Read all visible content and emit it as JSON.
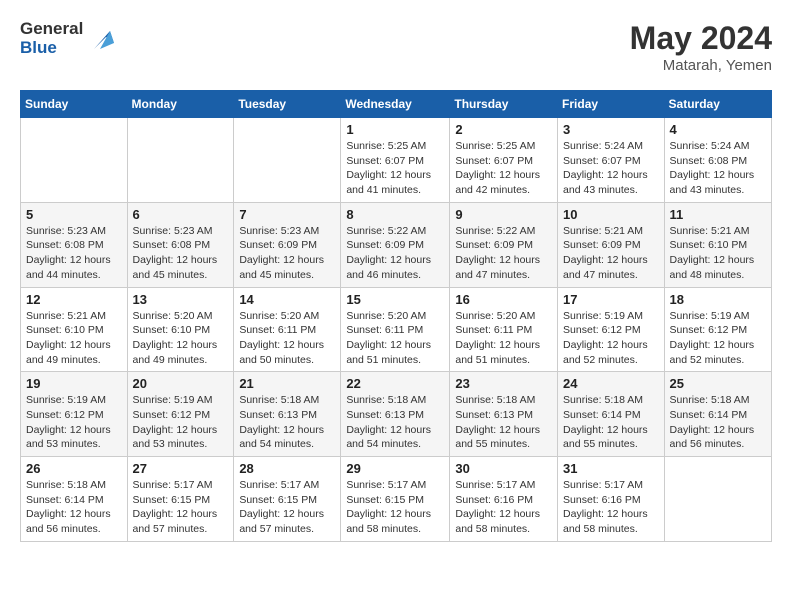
{
  "header": {
    "logo_line1": "General",
    "logo_line2": "Blue",
    "month_year": "May 2024",
    "location": "Matarah, Yemen"
  },
  "weekdays": [
    "Sunday",
    "Monday",
    "Tuesday",
    "Wednesday",
    "Thursday",
    "Friday",
    "Saturday"
  ],
  "weeks": [
    [
      {
        "day": "",
        "info": ""
      },
      {
        "day": "",
        "info": ""
      },
      {
        "day": "",
        "info": ""
      },
      {
        "day": "1",
        "info": "Sunrise: 5:25 AM\nSunset: 6:07 PM\nDaylight: 12 hours\nand 41 minutes."
      },
      {
        "day": "2",
        "info": "Sunrise: 5:25 AM\nSunset: 6:07 PM\nDaylight: 12 hours\nand 42 minutes."
      },
      {
        "day": "3",
        "info": "Sunrise: 5:24 AM\nSunset: 6:07 PM\nDaylight: 12 hours\nand 43 minutes."
      },
      {
        "day": "4",
        "info": "Sunrise: 5:24 AM\nSunset: 6:08 PM\nDaylight: 12 hours\nand 43 minutes."
      }
    ],
    [
      {
        "day": "5",
        "info": "Sunrise: 5:23 AM\nSunset: 6:08 PM\nDaylight: 12 hours\nand 44 minutes."
      },
      {
        "day": "6",
        "info": "Sunrise: 5:23 AM\nSunset: 6:08 PM\nDaylight: 12 hours\nand 45 minutes."
      },
      {
        "day": "7",
        "info": "Sunrise: 5:23 AM\nSunset: 6:09 PM\nDaylight: 12 hours\nand 45 minutes."
      },
      {
        "day": "8",
        "info": "Sunrise: 5:22 AM\nSunset: 6:09 PM\nDaylight: 12 hours\nand 46 minutes."
      },
      {
        "day": "9",
        "info": "Sunrise: 5:22 AM\nSunset: 6:09 PM\nDaylight: 12 hours\nand 47 minutes."
      },
      {
        "day": "10",
        "info": "Sunrise: 5:21 AM\nSunset: 6:09 PM\nDaylight: 12 hours\nand 47 minutes."
      },
      {
        "day": "11",
        "info": "Sunrise: 5:21 AM\nSunset: 6:10 PM\nDaylight: 12 hours\nand 48 minutes."
      }
    ],
    [
      {
        "day": "12",
        "info": "Sunrise: 5:21 AM\nSunset: 6:10 PM\nDaylight: 12 hours\nand 49 minutes."
      },
      {
        "day": "13",
        "info": "Sunrise: 5:20 AM\nSunset: 6:10 PM\nDaylight: 12 hours\nand 49 minutes."
      },
      {
        "day": "14",
        "info": "Sunrise: 5:20 AM\nSunset: 6:11 PM\nDaylight: 12 hours\nand 50 minutes."
      },
      {
        "day": "15",
        "info": "Sunrise: 5:20 AM\nSunset: 6:11 PM\nDaylight: 12 hours\nand 51 minutes."
      },
      {
        "day": "16",
        "info": "Sunrise: 5:20 AM\nSunset: 6:11 PM\nDaylight: 12 hours\nand 51 minutes."
      },
      {
        "day": "17",
        "info": "Sunrise: 5:19 AM\nSunset: 6:12 PM\nDaylight: 12 hours\nand 52 minutes."
      },
      {
        "day": "18",
        "info": "Sunrise: 5:19 AM\nSunset: 6:12 PM\nDaylight: 12 hours\nand 52 minutes."
      }
    ],
    [
      {
        "day": "19",
        "info": "Sunrise: 5:19 AM\nSunset: 6:12 PM\nDaylight: 12 hours\nand 53 minutes."
      },
      {
        "day": "20",
        "info": "Sunrise: 5:19 AM\nSunset: 6:12 PM\nDaylight: 12 hours\nand 53 minutes."
      },
      {
        "day": "21",
        "info": "Sunrise: 5:18 AM\nSunset: 6:13 PM\nDaylight: 12 hours\nand 54 minutes."
      },
      {
        "day": "22",
        "info": "Sunrise: 5:18 AM\nSunset: 6:13 PM\nDaylight: 12 hours\nand 54 minutes."
      },
      {
        "day": "23",
        "info": "Sunrise: 5:18 AM\nSunset: 6:13 PM\nDaylight: 12 hours\nand 55 minutes."
      },
      {
        "day": "24",
        "info": "Sunrise: 5:18 AM\nSunset: 6:14 PM\nDaylight: 12 hours\nand 55 minutes."
      },
      {
        "day": "25",
        "info": "Sunrise: 5:18 AM\nSunset: 6:14 PM\nDaylight: 12 hours\nand 56 minutes."
      }
    ],
    [
      {
        "day": "26",
        "info": "Sunrise: 5:18 AM\nSunset: 6:14 PM\nDaylight: 12 hours\nand 56 minutes."
      },
      {
        "day": "27",
        "info": "Sunrise: 5:17 AM\nSunset: 6:15 PM\nDaylight: 12 hours\nand 57 minutes."
      },
      {
        "day": "28",
        "info": "Sunrise: 5:17 AM\nSunset: 6:15 PM\nDaylight: 12 hours\nand 57 minutes."
      },
      {
        "day": "29",
        "info": "Sunrise: 5:17 AM\nSunset: 6:15 PM\nDaylight: 12 hours\nand 58 minutes."
      },
      {
        "day": "30",
        "info": "Sunrise: 5:17 AM\nSunset: 6:16 PM\nDaylight: 12 hours\nand 58 minutes."
      },
      {
        "day": "31",
        "info": "Sunrise: 5:17 AM\nSunset: 6:16 PM\nDaylight: 12 hours\nand 58 minutes."
      },
      {
        "day": "",
        "info": ""
      }
    ]
  ]
}
